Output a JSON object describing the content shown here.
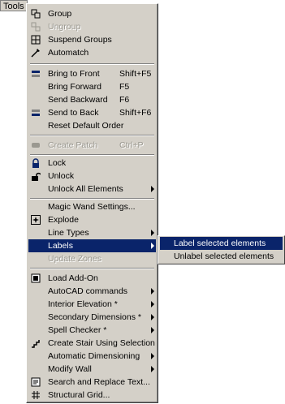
{
  "menubar": {
    "tools_label": "Tools"
  },
  "menu": {
    "group": "Group",
    "ungroup": "Ungroup",
    "suspend_groups": "Suspend Groups",
    "automatch": "Automatch",
    "bring_to_front": "Bring to Front",
    "bring_to_front_shortcut": "Shift+F5",
    "bring_forward": "Bring Forward",
    "bring_forward_shortcut": "F5",
    "send_backward": "Send Backward",
    "send_backward_shortcut": "F6",
    "send_to_back": "Send to Back",
    "send_to_back_shortcut": "Shift+F6",
    "reset_default_order": "Reset Default Order",
    "create_patch": "Create Patch",
    "create_patch_shortcut": "Ctrl+P",
    "lock": "Lock",
    "unlock": "Unlock",
    "unlock_all": "Unlock All Elements",
    "magic_wand": "Magic Wand Settings...",
    "explode": "Explode",
    "line_types": "Line Types",
    "labels": "Labels",
    "update_zones": "Update Zones",
    "load_addon": "Load Add-On",
    "autocad_commands": "AutoCAD commands",
    "interior_elevation": "Interior Elevation *",
    "secondary_dimensions": "Secondary Dimensions *",
    "spell_checker": "Spell Checker *",
    "create_stair": "Create Stair Using Selection",
    "automatic_dimensioning": "Automatic Dimensioning",
    "modify_wall": "Modify Wall",
    "search_replace": "Search and Replace Text...",
    "structural_grid": "Structural Grid..."
  },
  "submenu": {
    "label_selected": "Label selected elements",
    "unlabel_selected": "Unlabel selected elements"
  },
  "colors": {
    "menu_face": "#d4d0c8",
    "highlight": "#0a246a",
    "disabled_text": "#9a9890"
  },
  "icons": {
    "group": "group-icon",
    "ungroup": "ungroup-icon",
    "suspend_groups": "suspend-groups-icon",
    "automatch": "automatch-icon",
    "bring_to_front": "bring-to-front-icon",
    "send_to_back": "send-to-back-icon",
    "create_patch": "patch-icon",
    "lock": "lock-icon",
    "unlock": "unlock-icon",
    "explode": "explode-icon",
    "load_addon": "addon-icon",
    "create_stair": "stair-icon",
    "search_replace": "search-replace-icon",
    "structural_grid": "grid-icon"
  }
}
